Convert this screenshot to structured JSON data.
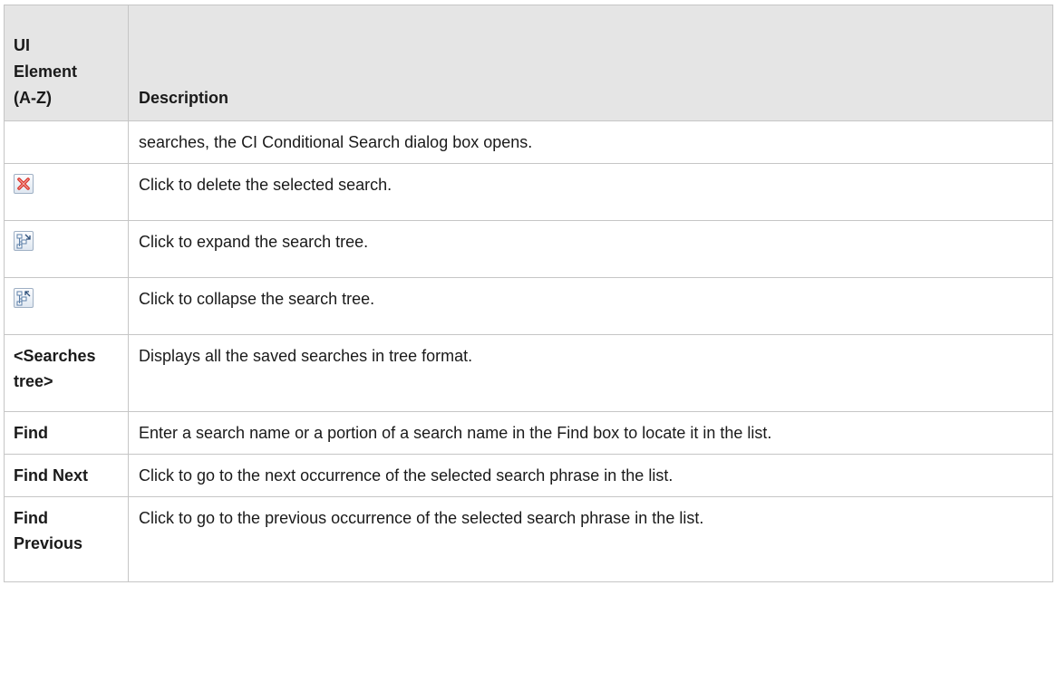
{
  "table": {
    "header": {
      "col1": "UI Element (A-Z)",
      "col1_lines": [
        "UI",
        "Element",
        "(A-Z)"
      ],
      "col2": "Description"
    },
    "rows": [
      {
        "element": "",
        "description": "searches, the CI Conditional Search dialog box opens."
      },
      {
        "element_icon": "delete-icon",
        "description": "Click to delete the selected search."
      },
      {
        "element_icon": "expand-tree-icon",
        "description": "Click to expand the search tree."
      },
      {
        "element_icon": "collapse-tree-icon",
        "description": "Click to collapse the search tree."
      },
      {
        "element": "<Searches tree>",
        "description": "Displays all the saved searches in tree format."
      },
      {
        "element": "Find",
        "description": "Enter a search name or a portion of a search name in the Find box to locate it in the list."
      },
      {
        "element": "Find Next",
        "description": "Click to go to the next occurrence of the selected search phrase in the list."
      },
      {
        "element": "Find Previous",
        "description": "Click to go to the previous occurrence of the selected search phrase in the list."
      }
    ]
  },
  "colors": {
    "header_bg": "#e5e5e5",
    "border": "#c6c6c6",
    "delete_icon": "#d9342b"
  }
}
